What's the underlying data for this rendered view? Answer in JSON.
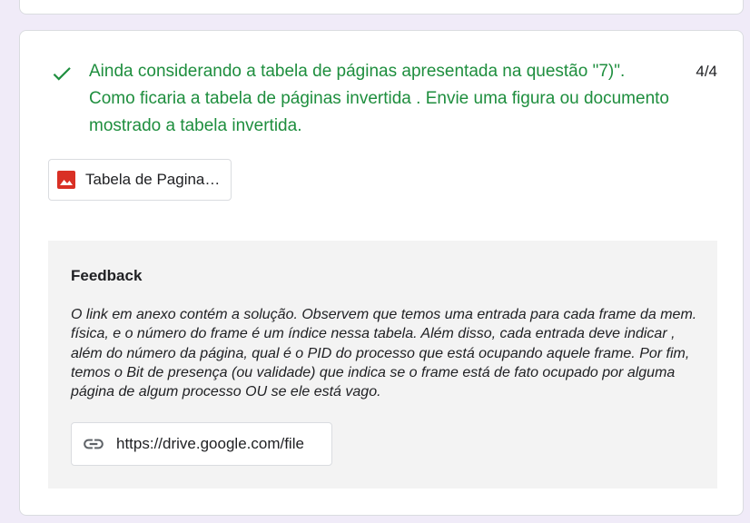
{
  "question": {
    "text": "Ainda considerando a tabela de páginas apresentada na questão \"7)\". Como ficaria a tabela de páginas invertida . Envie uma figura ou documento mostrado a tabela invertida.",
    "score": "4/4",
    "status_icon": "check-icon"
  },
  "attachment": {
    "label": "Tabela de Paginas Invertida",
    "icon": "image-icon"
  },
  "feedback": {
    "heading": "Feedback",
    "body": "O link em anexo contém a solução. Observem que temos uma entrada para cada frame da mem. física, e o número do frame é um índice nessa tabela. Além disso, cada entrada deve indicar , além do número da página, qual é o PID do processo que está ocupando aquele frame. Por fim, temos o Bit de presença (ou validade) que indica se o frame está de fato ocupado por alguma página de algum processo OU se ele está vago.",
    "link": {
      "label": "https://drive.google.com/file",
      "icon": "link-icon"
    }
  },
  "colors": {
    "correct_green": "#1e8e3e",
    "image_red": "#d93025",
    "page_background": "#f0ebf8",
    "feedback_background": "#f3f3f3"
  }
}
